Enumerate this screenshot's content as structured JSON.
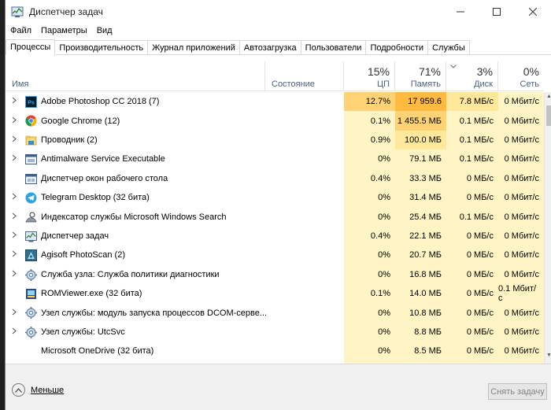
{
  "window": {
    "title": "Диспетчер задач"
  },
  "menu": [
    "Файл",
    "Параметры",
    "Вид"
  ],
  "tabs": [
    "Процессы",
    "Производительность",
    "Журнал приложений",
    "Автозагрузка",
    "Пользователи",
    "Подробности",
    "Службы"
  ],
  "active_tab": "Процессы",
  "columns": {
    "name": {
      "label": "Имя"
    },
    "status": {
      "label": "Состояние"
    },
    "cpu": {
      "pct": "15%",
      "label": "ЦП"
    },
    "memory": {
      "pct": "71%",
      "label": "Память"
    },
    "disk": {
      "pct": "3%",
      "label": "Диск"
    },
    "network": {
      "pct": "0%",
      "label": "Сеть"
    }
  },
  "processes": [
    {
      "name": "Adobe Photoshop CC 2018 (7)",
      "icon": "photoshop-icon",
      "expandable": true,
      "cpu": "12.7%",
      "memory": "17 959.6",
      "disk": "7.8 МБ/с",
      "network": "0 Мбит/с"
    },
    {
      "name": "Google Chrome (12)",
      "icon": "chrome-icon",
      "expandable": true,
      "cpu": "0.1%",
      "memory": "1 455.5 МБ",
      "disk": "0.1 МБ/с",
      "network": "0 Мбит/с"
    },
    {
      "name": "Проводник (2)",
      "icon": "explorer-icon",
      "expandable": true,
      "cpu": "0.9%",
      "memory": "100.0 МБ",
      "disk": "0.1 МБ/с",
      "network": "0 Мбит/с"
    },
    {
      "name": "Antimalware Service Executable",
      "icon": "service-window-icon",
      "expandable": true,
      "cpu": "0%",
      "memory": "79.1 МБ",
      "disk": "0.1 МБ/с",
      "network": "0 Мбит/с"
    },
    {
      "name": "Диспетчер окон рабочего стола",
      "icon": "window-manager-icon",
      "expandable": false,
      "cpu": "0.4%",
      "memory": "33.3 МБ",
      "disk": "0 МБ/с",
      "network": "0 Мбит/с"
    },
    {
      "name": "Telegram Desktop (32 бита)",
      "icon": "telegram-icon",
      "expandable": true,
      "cpu": "0%",
      "memory": "31.4 МБ",
      "disk": "0 МБ/с",
      "network": "0 Мбит/с"
    },
    {
      "name": "Индексатор службы Microsoft Windows Search",
      "icon": "search-indexer-icon",
      "expandable": true,
      "cpu": "0%",
      "memory": "25.4 МБ",
      "disk": "0.1 МБ/с",
      "network": "0 Мбит/с"
    },
    {
      "name": "Диспетчер задач",
      "icon": "task-manager-icon",
      "expandable": true,
      "cpu": "0.4%",
      "memory": "22.1 МБ",
      "disk": "0 МБ/с",
      "network": "0 Мбит/с"
    },
    {
      "name": "Agisoft PhotoScan (2)",
      "icon": "photoscan-icon",
      "expandable": true,
      "cpu": "0%",
      "memory": "20.7 МБ",
      "disk": "0 МБ/с",
      "network": "0 Мбит/с"
    },
    {
      "name": "Служба узла: Служба политики диагностики",
      "icon": "gear-icon",
      "expandable": true,
      "cpu": "0%",
      "memory": "16.8 МБ",
      "disk": "0 МБ/с",
      "network": "0 Мбит/с"
    },
    {
      "name": "ROMViewer.exe (32 бита)",
      "icon": "romviewer-icon",
      "expandable": false,
      "cpu": "0.1%",
      "memory": "14.0 МБ",
      "disk": "0 МБ/с",
      "network": "0.1 Мбит/с"
    },
    {
      "name": "Узел службы: модуль запуска процессов DCOM-серве...",
      "icon": "gear-icon",
      "expandable": true,
      "cpu": "0%",
      "memory": "10.8 МБ",
      "disk": "0 МБ/с",
      "network": "0 Мбит/с"
    },
    {
      "name": "Узел службы: UtcSvc",
      "icon": "gear-icon",
      "expandable": true,
      "cpu": "0%",
      "memory": "8.8 МБ",
      "disk": "0 МБ/с",
      "network": "0 Мбит/с"
    },
    {
      "name": "Microsoft OneDrive (32 бита)",
      "icon": "onedrive-icon",
      "expandable": false,
      "cpu": "0%",
      "memory": "8.5 МБ",
      "disk": "0 МБ/с",
      "network": "0 Мбит/с"
    }
  ],
  "footer": {
    "less_label": "Меньше",
    "end_task_label": "Снять задачу"
  },
  "colors": {
    "heat_light": "#fff4c4",
    "heat_medium": "#ffe89a",
    "heat_hot": "#ffd373",
    "heat_very_hot": "#ffba3f",
    "header_label": "#4d6082",
    "footer_bg": "#f0f0f0"
  }
}
